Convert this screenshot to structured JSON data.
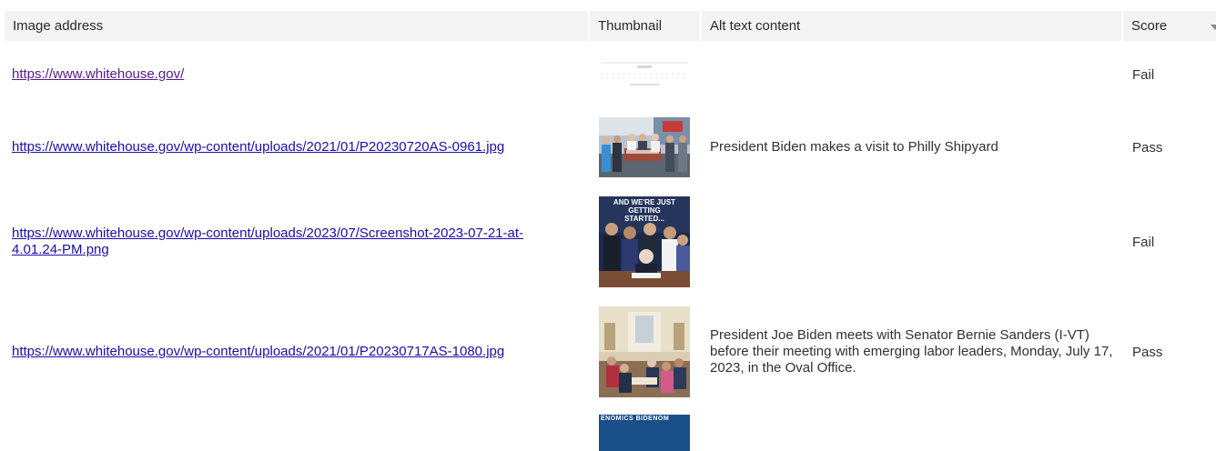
{
  "table": {
    "headers": {
      "image_address": "Image address",
      "thumbnail": "Thumbnail",
      "alt_text": "Alt text content",
      "score": "Score"
    },
    "sort_icon": "chevron-down-icon",
    "rows": [
      {
        "url": "https://www.whitehouse.gov/",
        "alt": "",
        "score": "Fail",
        "thumb": "whitehouse-logo"
      },
      {
        "url": "https://www.whitehouse.gov/wp-content/uploads/2021/01/P20230720AS-0961.jpg",
        "alt": "President Biden makes a visit to Philly Shipyard",
        "score": "Pass",
        "thumb": "shipyard-photo"
      },
      {
        "url": "https://www.whitehouse.gov/wp-content/uploads/2023/07/Screenshot-2023-07-21-at-4.01.24-PM.png",
        "alt": "",
        "score": "Fail",
        "thumb": "signing-photo",
        "thumb_caption": "AND WE'RE JUST GETTING STARTED..."
      },
      {
        "url": "https://www.whitehouse.gov/wp-content/uploads/2021/01/P20230717AS-1080.jpg",
        "alt": "President Joe Biden meets with Senator Bernie Sanders (I-VT) before their meeting with emerging labor leaders, Monday, July 17, 2023, in the Oval Office.",
        "score": "Pass",
        "thumb": "oval-office-photo"
      },
      {
        "url": "",
        "alt": "",
        "score": "",
        "thumb": "bidenomics-banner",
        "thumb_caption": "ENOMICS BIDENOM"
      }
    ]
  }
}
